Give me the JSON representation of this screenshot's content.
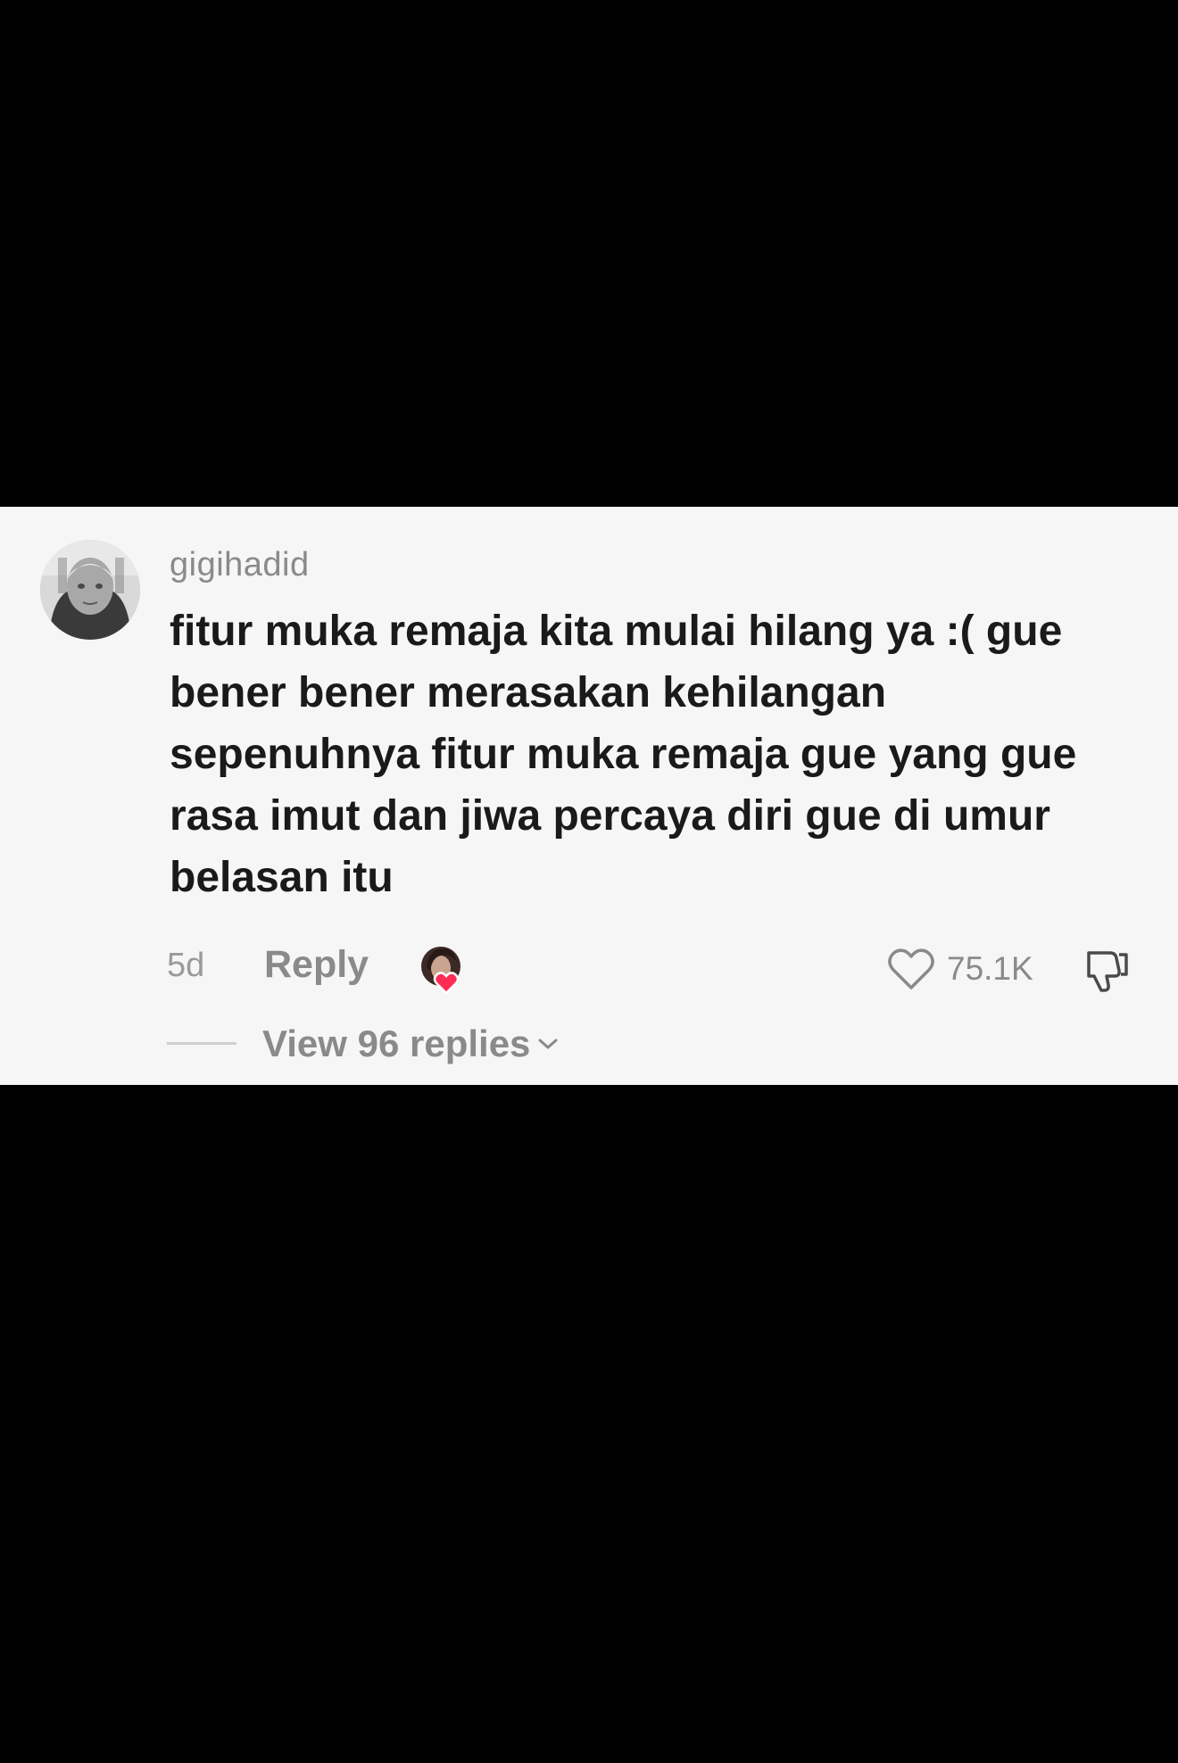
{
  "comment": {
    "username": "gigihadid",
    "text_lines": [
      "fitur muka remaja kita mulai hilang ya :( gue",
      "bener bener merasakan kehilangan",
      "sepenuhnya fitur muka remaja gue yang gue",
      "rasa imut dan jiwa percaya diri gue di umur",
      "belasan itu"
    ],
    "age": "5d",
    "reply_label": "Reply",
    "like_count": "75.1K",
    "view_replies_label": "View 96 replies"
  },
  "icons": {
    "avatar": "user-avatar",
    "creator_liked": "creator-liked-badge",
    "like": "heart-outline-icon",
    "dislike": "thumbs-down-icon",
    "expand": "chevron-down-icon"
  },
  "colors": {
    "background": "#000000",
    "card": "#f6f6f6",
    "text_primary": "#1a1a1a",
    "text_secondary": "#8a8a8a",
    "heart_badge": "#fe2c55"
  }
}
